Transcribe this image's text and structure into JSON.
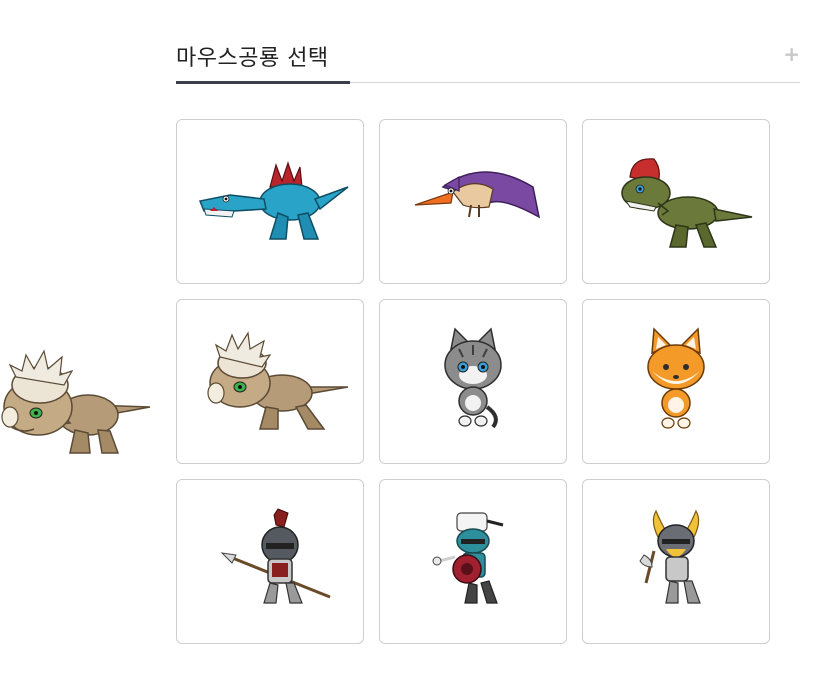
{
  "header": {
    "title": "마우스공룡 선택",
    "expand_icon": "plus-icon"
  },
  "cursor_preview": {
    "icon": "pachycephalosaurus-sprite"
  },
  "characters": [
    {
      "name": "spinosaurus",
      "icon": "spinosaurus-sprite",
      "colors": [
        "#2aa3c9",
        "#b8232c"
      ]
    },
    {
      "name": "pteranodon",
      "icon": "pteranodon-sprite",
      "colors": [
        "#7a4aa3",
        "#f0701f"
      ]
    },
    {
      "name": "dilophosaurus",
      "icon": "dilophosaurus-sprite",
      "colors": [
        "#6b7a3a",
        "#c72e2e"
      ]
    },
    {
      "name": "pachycephalosaurus",
      "icon": "pachycephalosaurus-sprite",
      "colors": [
        "#b59b78",
        "#e8e0cf"
      ]
    },
    {
      "name": "gray-cat",
      "icon": "gray-cat-sprite",
      "colors": [
        "#8c8c8c",
        "#3aa0d8"
      ]
    },
    {
      "name": "fox",
      "icon": "fox-sprite",
      "colors": [
        "#f39a28",
        "#fff4e6"
      ]
    },
    {
      "name": "spear-knight",
      "icon": "spear-knight-sprite",
      "colors": [
        "#555a60",
        "#8a1f1f"
      ]
    },
    {
      "name": "chef-knight",
      "icon": "chef-knight-sprite",
      "colors": [
        "#2d8f9c",
        "#a02030"
      ]
    },
    {
      "name": "viking",
      "icon": "viking-sprite",
      "colors": [
        "#6a6e74",
        "#f2c13a"
      ]
    }
  ]
}
